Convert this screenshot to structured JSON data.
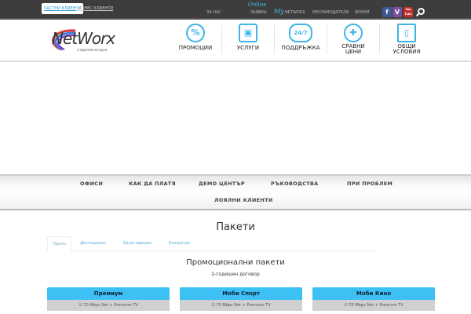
{
  "topbar": {
    "segments": [
      "ЧАСТНИ КЛИЕНТИ",
      "БИЗНЕС КЛИЕНТИ"
    ],
    "links": {
      "about": "ЗА НАС",
      "online": "Online",
      "request": "ЗАЯВКА",
      "my": "My",
      "network": "NETWORX",
      "advertisers": "РЕКЛАМОДАТЕЛИ",
      "forum": "ФОРУМ"
    },
    "social": [
      "f",
      "V",
      "You Tube"
    ]
  },
  "logo": {
    "name": "NetWorx",
    "tagline": "споделяй изгодно"
  },
  "nav": [
    {
      "label": "ПРОМОЦИИ",
      "icon": "%"
    },
    {
      "label": "УСЛУГИ",
      "icon": "▣"
    },
    {
      "label": "ПОДДРЪЖКА",
      "icon": "24/7"
    },
    {
      "label": "СРАВНИ ЦЕНИ",
      "icon": "✚"
    },
    {
      "label": "ОБЩИ УСЛОВИЯ",
      "icon": "▯"
    }
  ],
  "menu": [
    "ОФИСИ",
    "КАК ДА ПЛАТЯ",
    "ДЕМО ЦЕНТЪР",
    "РЪКОВОДСТВА",
    "ПРИ ПРОБЛЕМ",
    "ЛОЯЛНИ КЛИЕНТИ"
  ],
  "page": {
    "title": "Пакети",
    "tabs": [
      "Промо",
      "Двугодишен",
      "Едногодишен",
      "Безсрочен"
    ],
    "section_title": "Промоционални пакети",
    "contract": "2-годишен договор"
  },
  "cards": [
    {
      "name": "Премиум",
      "feature": "☑ 70 Mbps Net + Premium TV"
    },
    {
      "name": "Моби Спорт",
      "feature": "☑ 70 Mbps Net + Premium TV"
    },
    {
      "name": "Моби Кино",
      "feature": "☑ 70 Mbps Net + Premium TV"
    }
  ],
  "colors": {
    "accent": "#3dc1f5",
    "topbar": "#3d3d3d"
  }
}
